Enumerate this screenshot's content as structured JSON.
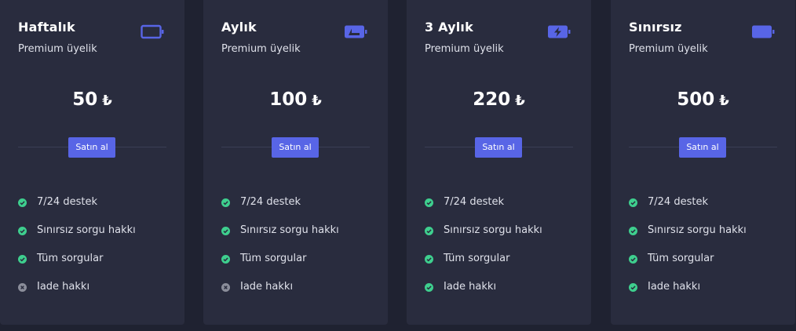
{
  "plans": [
    {
      "title": "Haftalık",
      "subtitle": "Premium üyelik",
      "icon": "battery-empty-icon",
      "price": "50",
      "currency": "₺",
      "button_label": "Satın al",
      "features": [
        {
          "label": "7/24 destek",
          "included": true
        },
        {
          "label": "Sınırsız sorgu hakkı",
          "included": true
        },
        {
          "label": "Tüm sorgular",
          "included": true
        },
        {
          "label": "Iade hakkı",
          "included": false
        }
      ]
    },
    {
      "title": "Aylık",
      "subtitle": "Premium üyelik",
      "icon": "battery-half-icon",
      "price": "100",
      "currency": "₺",
      "button_label": "Satın al",
      "features": [
        {
          "label": "7/24 destek",
          "included": true
        },
        {
          "label": "Sınırsız sorgu hakkı",
          "included": true
        },
        {
          "label": "Tüm sorgular",
          "included": true
        },
        {
          "label": "Iade hakkı",
          "included": false
        }
      ]
    },
    {
      "title": "3 Aylık",
      "subtitle": "Premium üyelik",
      "icon": "battery-charging-icon",
      "price": "220",
      "currency": "₺",
      "button_label": "Satın al",
      "features": [
        {
          "label": "7/24 destek",
          "included": true
        },
        {
          "label": "Sınırsız sorgu hakkı",
          "included": true
        },
        {
          "label": "Tüm sorgular",
          "included": true
        },
        {
          "label": "Iade hakkı",
          "included": true
        }
      ]
    },
    {
      "title": "Sınırsız",
      "subtitle": "Premium üyelik",
      "icon": "battery-full-icon",
      "price": "500",
      "currency": "₺",
      "button_label": "Satın al",
      "features": [
        {
          "label": "7/24 destek",
          "included": true
        },
        {
          "label": "Sınırsız sorgu hakkı",
          "included": true
        },
        {
          "label": "Tüm sorgular",
          "included": true
        },
        {
          "label": "Iade hakkı",
          "included": true
        }
      ]
    }
  ],
  "colors": {
    "page_bg": "#1f2231",
    "card_bg": "#292c3e",
    "accent": "#5865e6",
    "included": "#3ecf8e",
    "excluded": "#8a8d9a"
  }
}
